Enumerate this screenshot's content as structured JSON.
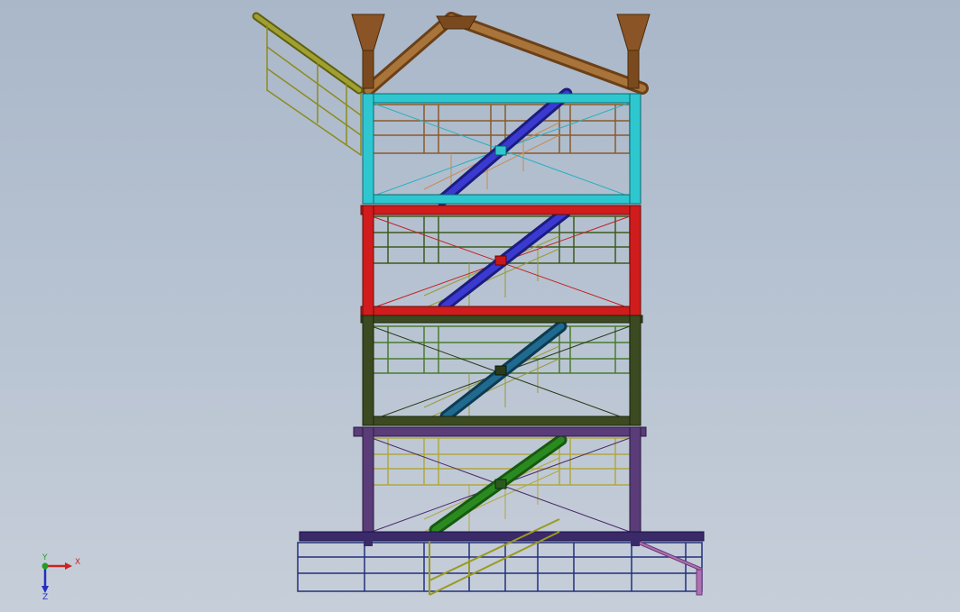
{
  "viewport": {
    "background_top": "#a9b7c9",
    "background_bottom": "#c6ced9"
  },
  "model": {
    "colors": {
      "top_frame": "#2ec7d0",
      "level2_frame": "#c81818",
      "level3_frame": "#3c4a22",
      "level4_frame": "#5a3c78",
      "base_frame": "#3a2a6a",
      "roof_truss": "#8a5a2a",
      "railing_brown": "#8a5a2a",
      "railing_olive": "#8c8c20",
      "railing_green": "#4a7a30",
      "railing_yellow": "#b0a840",
      "base_railing": "#23307a",
      "stair_blue": "#2a2ab0",
      "stair_teal": "#1a5a7a",
      "stair_green": "#2a7a20",
      "handrail_olive": "#9a9a20",
      "ramp_pink": "#b070b0"
    }
  },
  "triad": {
    "x_label": "X",
    "y_label": "Y",
    "z_label": "Z",
    "x_color": "#d02020",
    "y_color": "#20a020",
    "z_color": "#2030c0"
  }
}
